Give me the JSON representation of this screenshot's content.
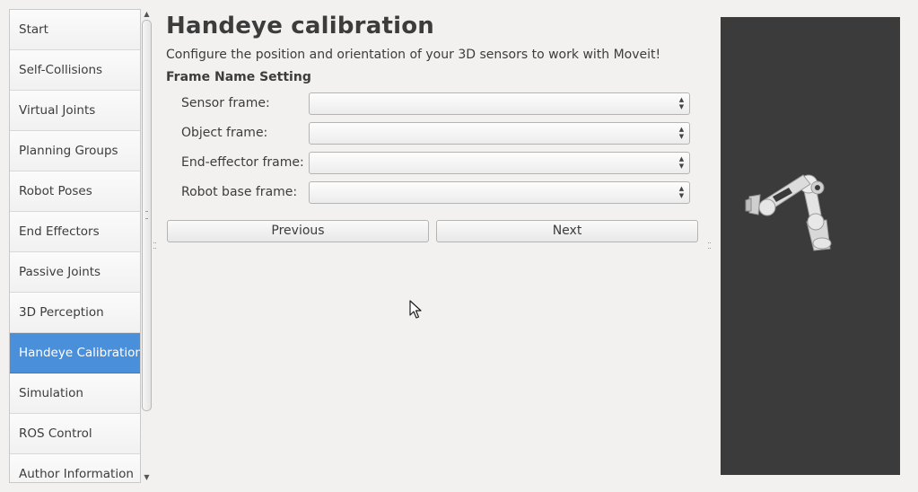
{
  "sidebar": {
    "items": [
      {
        "label": "Start"
      },
      {
        "label": "Self-Collisions"
      },
      {
        "label": "Virtual Joints"
      },
      {
        "label": "Planning Groups"
      },
      {
        "label": "Robot Poses"
      },
      {
        "label": "End Effectors"
      },
      {
        "label": "Passive Joints"
      },
      {
        "label": "3D Perception"
      },
      {
        "label": "Handeye Calibration",
        "active": true
      },
      {
        "label": "Simulation"
      },
      {
        "label": "ROS Control"
      },
      {
        "label": "Author Information"
      }
    ]
  },
  "main": {
    "title": "Handeye calibration",
    "description": "Configure the position and orientation of your 3D sensors to work with Moveit!",
    "section_title": "Frame Name Setting",
    "fields": [
      {
        "label": "Sensor frame:",
        "value": ""
      },
      {
        "label": "Object frame:",
        "value": ""
      },
      {
        "label": "End-effector frame:",
        "value": ""
      },
      {
        "label": "Robot base frame:",
        "value": ""
      }
    ],
    "buttons": {
      "previous": "Previous",
      "next": "Next"
    }
  },
  "colors": {
    "active_item": "#4a8fd9",
    "viewer_background": "#3b3b3b",
    "window_background": "#f2f1f0"
  }
}
